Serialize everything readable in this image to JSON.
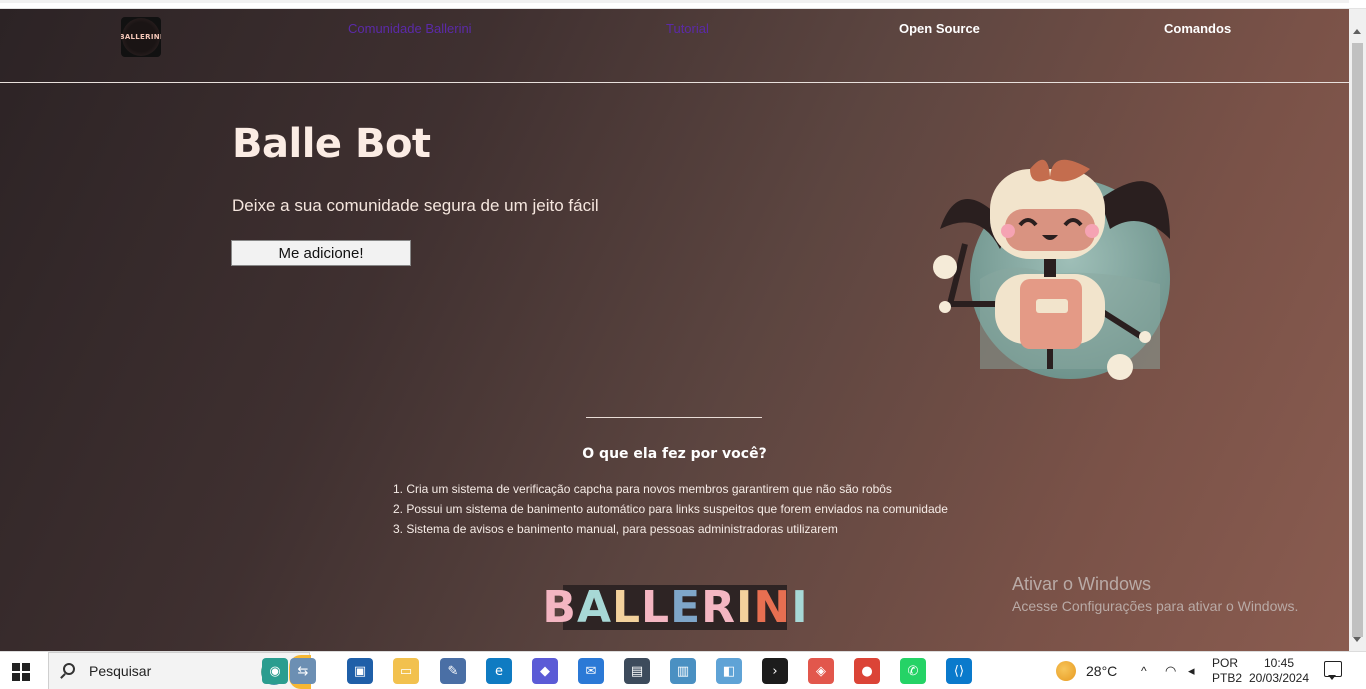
{
  "nav": {
    "logo_text": "BALLERINI",
    "links": [
      {
        "label": "Comunidade Ballerini"
      },
      {
        "label": "Tutorial"
      },
      {
        "label": "Open Source"
      },
      {
        "label": "Comandos"
      }
    ]
  },
  "hero": {
    "title": "Balle Bot",
    "subtitle": "Deixe a sua comunidade segura de um jeito fácil",
    "cta": "Me adicione!"
  },
  "features": {
    "title": "O que ela fez por você?",
    "items": [
      "1. Cria um sistema de verificação capcha para novos membros garantirem que não são robôs",
      "2. Possui um sistema de banimento automático para links suspeitos que forem enviados na comunidade",
      "3. Sistema de avisos e banimento manual, para pessoas administradoras utilizarem"
    ]
  },
  "brand": {
    "letters": [
      "B",
      "A",
      "L",
      "L",
      "E",
      "R",
      "I",
      "N",
      "I"
    ],
    "colors": [
      "#f4b6c2",
      "#a7d8d6",
      "#f3d19c",
      "#f4b6c2",
      "#7fa6c9",
      "#f4b6c2",
      "#f3d19c",
      "#e76f51",
      "#a7d8d6"
    ]
  },
  "watermark": {
    "line1": "Ativar o Windows",
    "line2": "Acesse Configurações para ativar o Windows."
  },
  "taskbar": {
    "search_placeholder": "Pesquisar",
    "apps": [
      "widgets-icon",
      "taskview-icon",
      "explorer-icon",
      "notepad-icon",
      "edge-icon",
      "copilot-icon",
      "mail-icon",
      "remote-desktop-icon",
      "network-monitor-icon",
      "paint-icon",
      "terminal-icon",
      "git-icon",
      "chrome-icon",
      "whatsapp-icon",
      "vscode-icon",
      "active-app-icon"
    ],
    "temperature": "28°C",
    "lang_line1": "POR",
    "lang_line2": "PTB2",
    "time": "10:45",
    "date": "20/03/2024"
  }
}
